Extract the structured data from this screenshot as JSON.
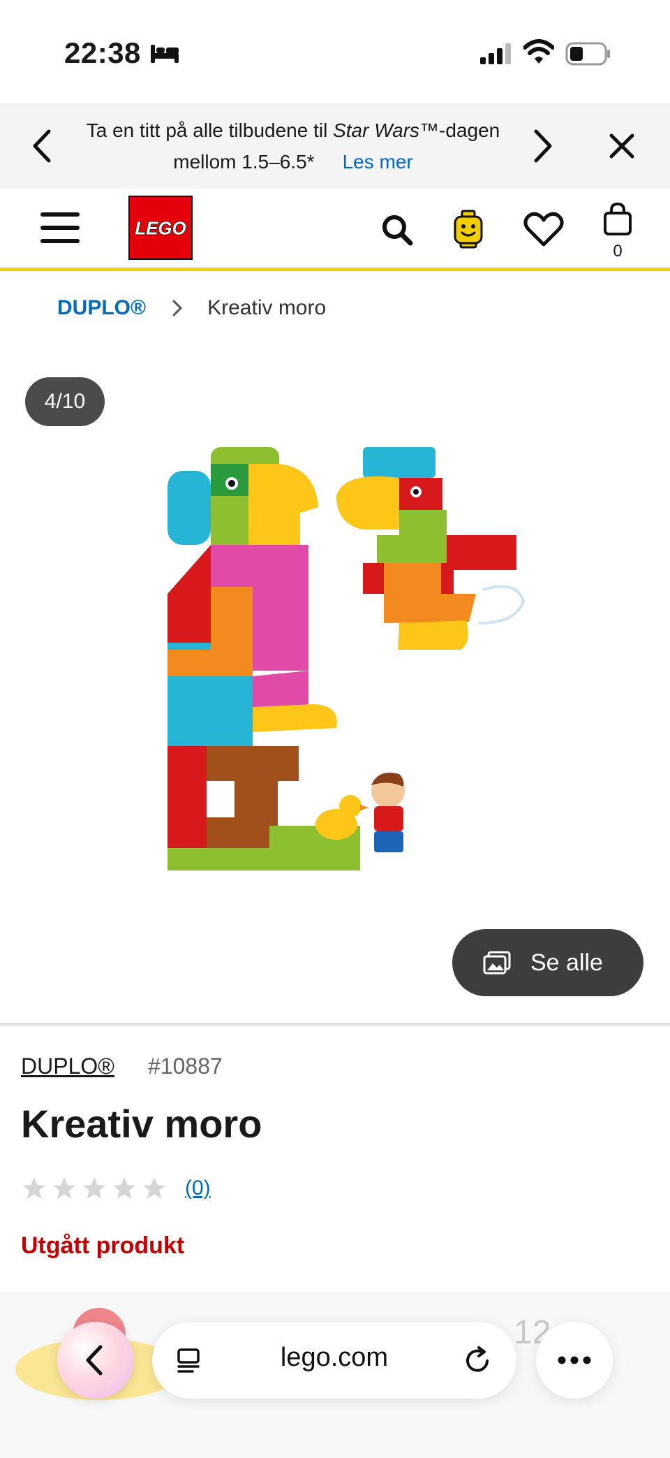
{
  "status_bar": {
    "time": "22:38",
    "icons": [
      "bed-icon",
      "signal-icon",
      "wifi-icon",
      "battery-icon"
    ]
  },
  "promo": {
    "text_before": "Ta en titt på alle tilbudene til ",
    "text_italic": "Star Wars",
    "text_after": "™-dagen mellom 1.5–6.5*",
    "link": "Les mer"
  },
  "header": {
    "logo_text": "LEGO",
    "cart_count": "0",
    "accent_color": "#f2cd00",
    "brand_color": "#e3000b"
  },
  "breadcrumb": {
    "parent": "DUPLO®",
    "current": "Kreativ moro"
  },
  "gallery": {
    "counter": "4/10",
    "see_all": "Se alle"
  },
  "product": {
    "theme": "DUPLO®",
    "item_number": "#10887",
    "title": "Kreativ moro",
    "rating_stars": 0,
    "review_count": "(0)",
    "availability": "Utgått produkt",
    "availability_color": "#c00000"
  },
  "browser": {
    "url": "lego.com",
    "partial_price": "12"
  }
}
